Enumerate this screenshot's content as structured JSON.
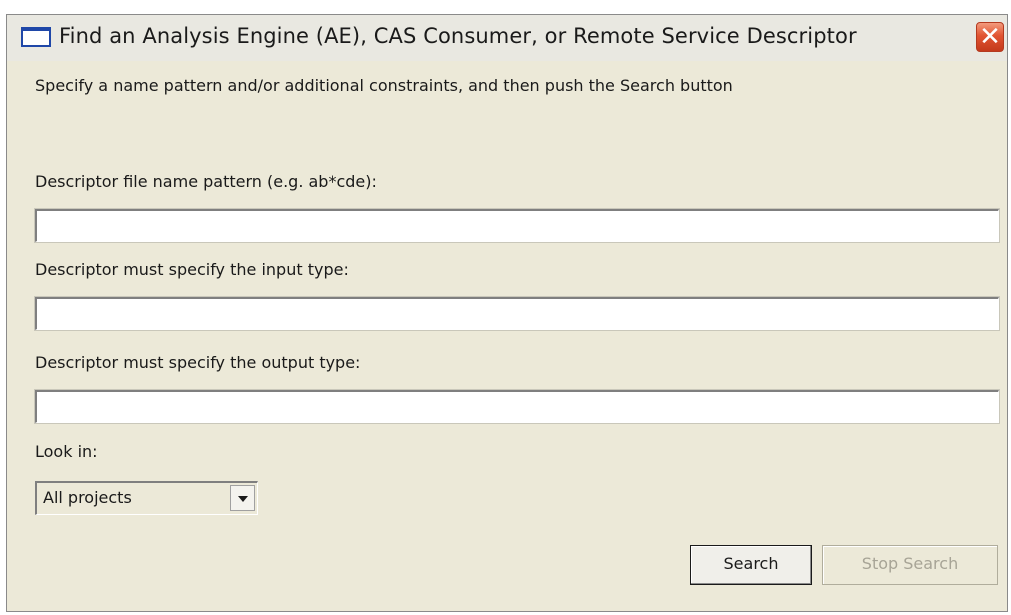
{
  "window": {
    "title": "Find an Analysis Engine (AE), CAS Consumer, or Remote Service Descriptor",
    "close_symbol": "✕"
  },
  "instructions": "Specify a name pattern and/or additional constraints, and then push the Search button",
  "fields": {
    "name_pattern": {
      "label": "Descriptor file name pattern (e.g. ab*cde):",
      "value": ""
    },
    "input_type": {
      "label": "Descriptor must specify the input type:",
      "value": ""
    },
    "output_type": {
      "label": "Descriptor must specify the output type:",
      "value": ""
    }
  },
  "look_in": {
    "label": "Look in:",
    "selected": "All projects"
  },
  "buttons": {
    "search": "Search",
    "stop_search": "Stop Search"
  },
  "icons": {
    "title": "window-icon",
    "close": "close-icon",
    "dropdown": "chevron-down-icon"
  },
  "colors": {
    "dialog_background": "#ece9d8",
    "close_button": "#e15432",
    "disabled_text": "#a7a496"
  }
}
